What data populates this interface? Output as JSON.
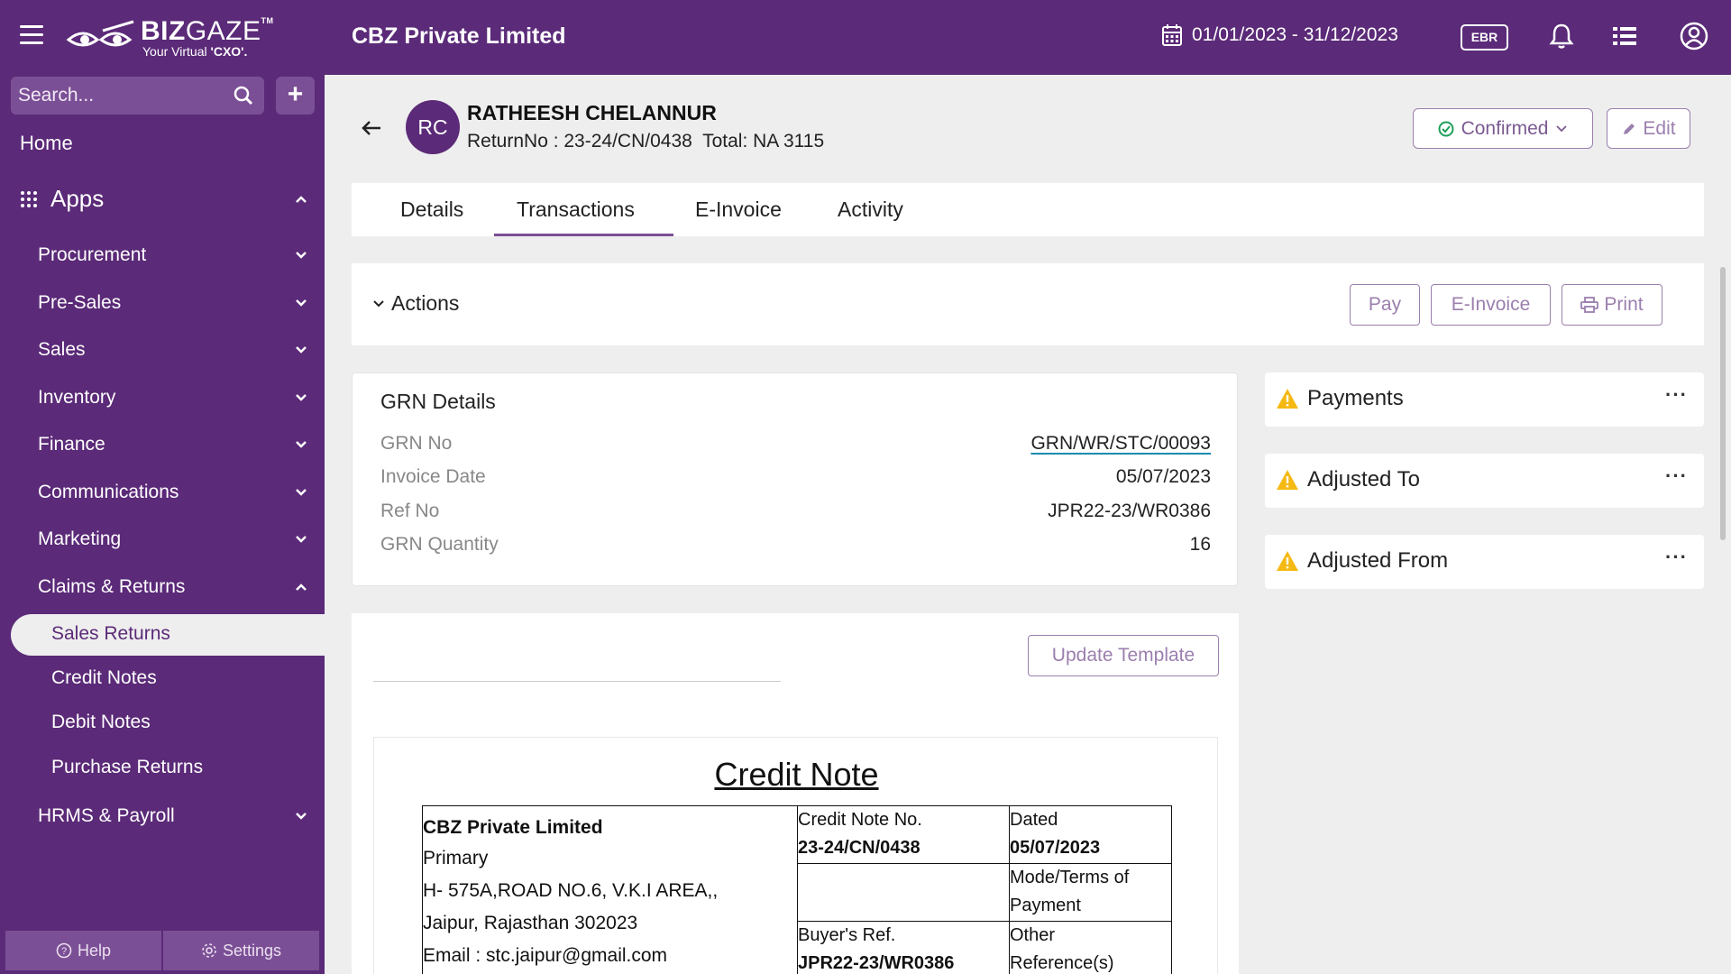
{
  "app": {
    "logo_main": "BIZ",
    "logo_thin": "GAZE",
    "logo_tm": "TM",
    "tagline_prefix": "Your Virtual ",
    "tagline_bold": "'CXO'.",
    "company": "CBZ Private Limited",
    "date_range": "01/01/2023 - 31/12/2023",
    "ebr_label": "EBR"
  },
  "sidebar": {
    "search_placeholder": "Search...",
    "home": "Home",
    "apps": "Apps",
    "items": [
      "Procurement",
      "Pre-Sales",
      "Sales",
      "Inventory",
      "Finance",
      "Communications",
      "Marketing",
      "Claims & Returns"
    ],
    "claims_sub": [
      "Sales Returns",
      "Credit Notes",
      "Debit Notes",
      "Purchase Returns"
    ],
    "active_sub": "Sales Returns",
    "hrms": "HRMS & Payroll",
    "help": "Help",
    "settings": "Settings"
  },
  "header": {
    "initials": "RC",
    "name": "RATHEESH CHELANNUR",
    "subtitle": "ReturnNo : 23-24/CN/0438  Total: NA 3115",
    "status": "Confirmed",
    "edit": "Edit"
  },
  "tabs": [
    "Details",
    "Transactions",
    "E-Invoice",
    "Activity"
  ],
  "active_tab": "Transactions",
  "actions": {
    "title": "Actions",
    "pay": "Pay",
    "einvoice": "E-Invoice",
    "print": "Print"
  },
  "grn": {
    "title": "GRN Details",
    "rows": [
      {
        "label": "GRN No",
        "value": "GRN/WR/STC/00093"
      },
      {
        "label": "Invoice Date",
        "value": "05/07/2023"
      },
      {
        "label": "Ref No",
        "value": "JPR22-23/WR0386"
      },
      {
        "label": "GRN Quantity",
        "value": "16"
      }
    ]
  },
  "side_cards": [
    "Payments",
    "Adjusted To",
    "Adjusted From"
  ],
  "document": {
    "update_template": "Update Template",
    "title": "Credit Note",
    "seller_name": "CBZ Private Limited",
    "seller_lines": [
      "Primary",
      "H- 575A,ROAD NO.6, V.K.I AREA,,",
      "Jaipur, Rajasthan 302023",
      "Email : stc.jaipur@gmail.com"
    ],
    "credit_note_label": "Credit Note No.",
    "credit_note_value": "23-24/CN/0438",
    "dated_label": "Dated",
    "dated_value": "05/07/2023",
    "mode_label_1": "Mode/Terms of",
    "mode_label_2": "Payment",
    "buyer_ref_label": "Buyer's Ref.",
    "buyer_ref_value": "JPR22-23/WR0386",
    "other_ref_1": "Other",
    "other_ref_2": "Reference(s)"
  },
  "colors": {
    "brand": "#5b2a78",
    "accent": "#7b4f95",
    "warning": "#f5b914",
    "success": "#1e9e5a"
  }
}
